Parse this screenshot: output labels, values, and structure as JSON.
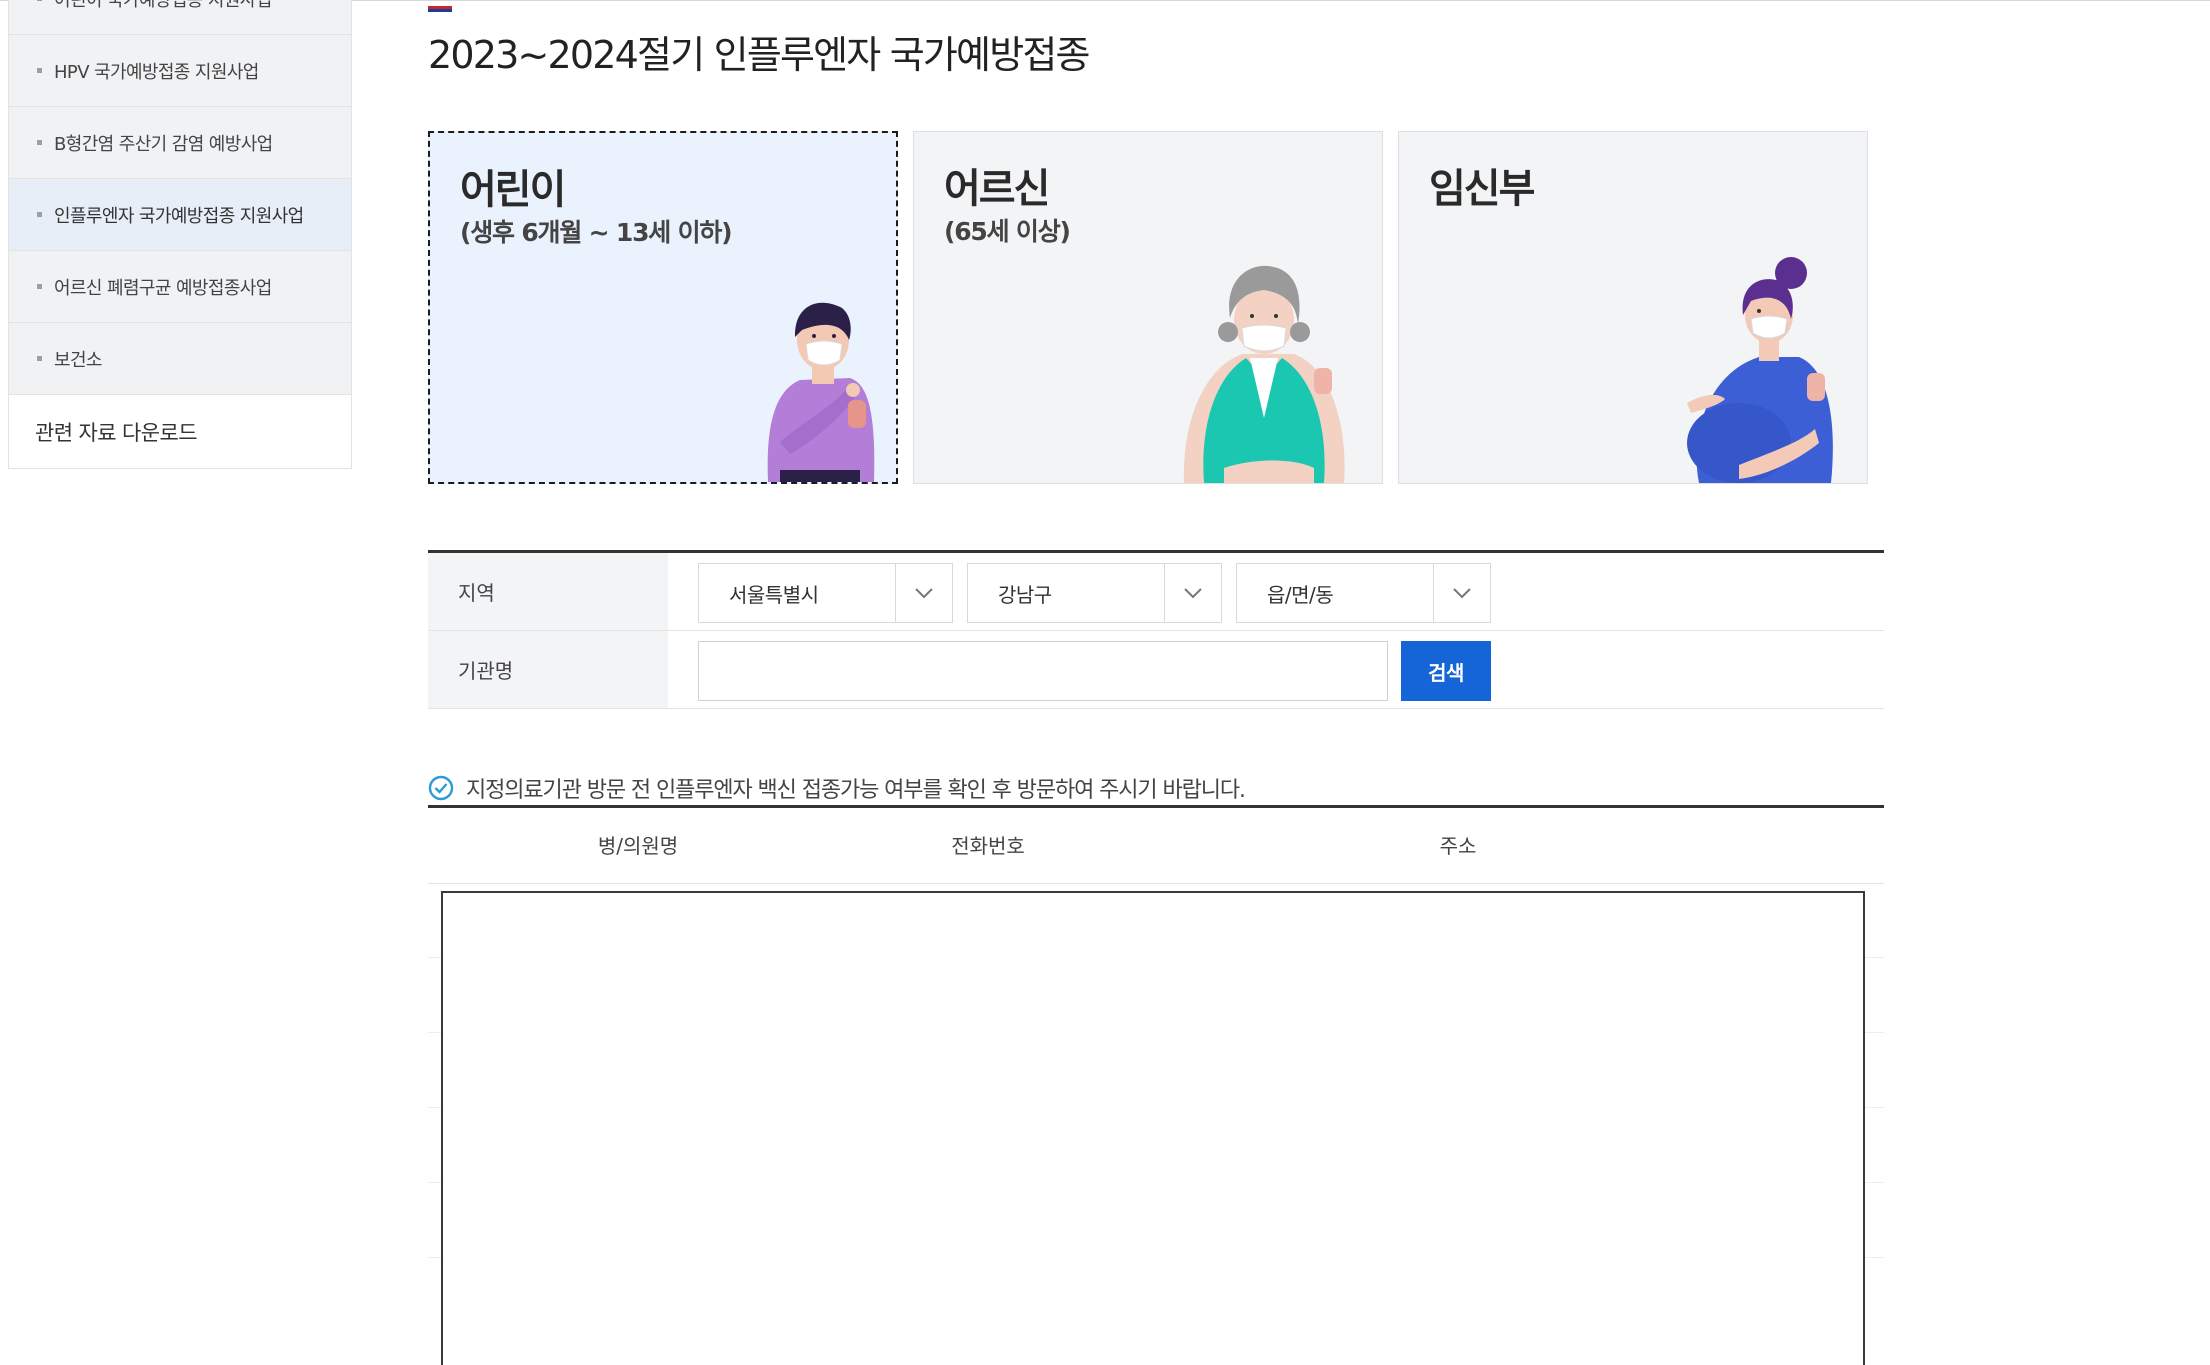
{
  "sidebar": {
    "items": [
      {
        "label": "어린이 국가예방접종 지원사업"
      },
      {
        "label": "HPV 국가예방접종 지원사업"
      },
      {
        "label": "B형간염 주산기 감염 예방사업"
      },
      {
        "label": "인플루엔자 국가예방접종 지원사업"
      },
      {
        "label": "어르신 폐렴구균 예방접종사업"
      },
      {
        "label": "보건소"
      }
    ],
    "download_label": "관련 자료 다운로드"
  },
  "page": {
    "title": "2023~2024절기 인플루엔자 국가예방접종"
  },
  "cards": [
    {
      "title": "어린이",
      "subtitle": "(생후 6개월 ~ 13세 이하)"
    },
    {
      "title": "어르신",
      "subtitle": "(65세 이상)"
    },
    {
      "title": "임신부",
      "subtitle": ""
    }
  ],
  "form": {
    "region_label": "지역",
    "region_values": [
      "서울특별시",
      "강남구",
      "읍/면/동"
    ],
    "name_label": "기관명",
    "name_value": "",
    "search_label": "검색"
  },
  "notice": "지정의료기관 방문 전 인플루엔자 백신 접종가능 여부를 확인 후 방문하여 주시기 바랍니다.",
  "results": {
    "columns": [
      "병/의원명",
      "전화번호",
      "주소"
    ]
  },
  "colors": {
    "accent": "#1565d8",
    "selected_card_bg": "#eaf3fd",
    "child_shirt": "#b37ed8",
    "senior_vest": "#1cc7b1",
    "pregnant_dress": "#3d5fd6"
  }
}
